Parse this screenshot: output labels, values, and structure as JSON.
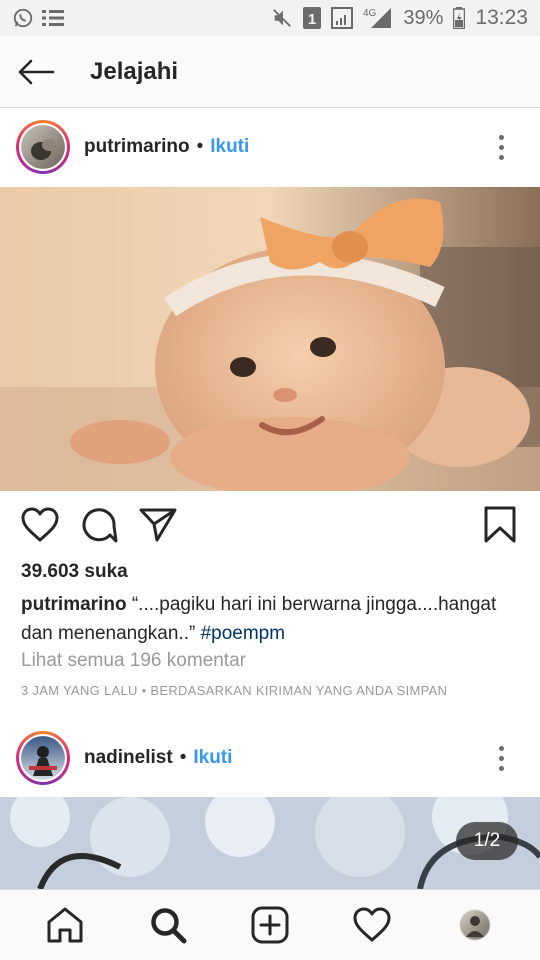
{
  "status_bar": {
    "battery_percent": "39%",
    "time": "13:23",
    "network": "4G",
    "sim_badge": "1",
    "left_icons": [
      "whatsapp-icon",
      "list-icon"
    ],
    "right_icons": [
      "mute-icon",
      "sim-icon",
      "signal-icon",
      "signal-4g-icon",
      "battery-icon"
    ]
  },
  "header": {
    "title": "Jelajahi",
    "back_icon": "arrow-left-icon"
  },
  "posts": [
    {
      "username": "putrimarino",
      "separator": "•",
      "follow_label": "Ikuti",
      "likes": "39.603 suka",
      "caption_user": "putrimarino",
      "caption_text": " “....pagiku hari ini berwarna jingga....hangat dan menenangkan..” ",
      "caption_tag": "#poempm",
      "view_comments": "Lihat semua 196 komentar",
      "timestamp": "3 JAM YANG LALU • BERDASARKAN KIRIMAN YANG ANDA SIMPAN"
    },
    {
      "username": "nadinelist",
      "separator": "•",
      "follow_label": "Ikuti",
      "image_counter": "1/2"
    }
  ],
  "action_icons": [
    "heart-icon",
    "comment-icon",
    "send-icon",
    "bookmark-icon"
  ],
  "bottom_nav": [
    "home-icon",
    "search-icon",
    "add-post-icon",
    "activity-heart-icon",
    "profile-avatar"
  ],
  "colors": {
    "link_blue": "#3897f0",
    "hashtag": "#003569",
    "muted": "#999999",
    "text": "#262626"
  }
}
